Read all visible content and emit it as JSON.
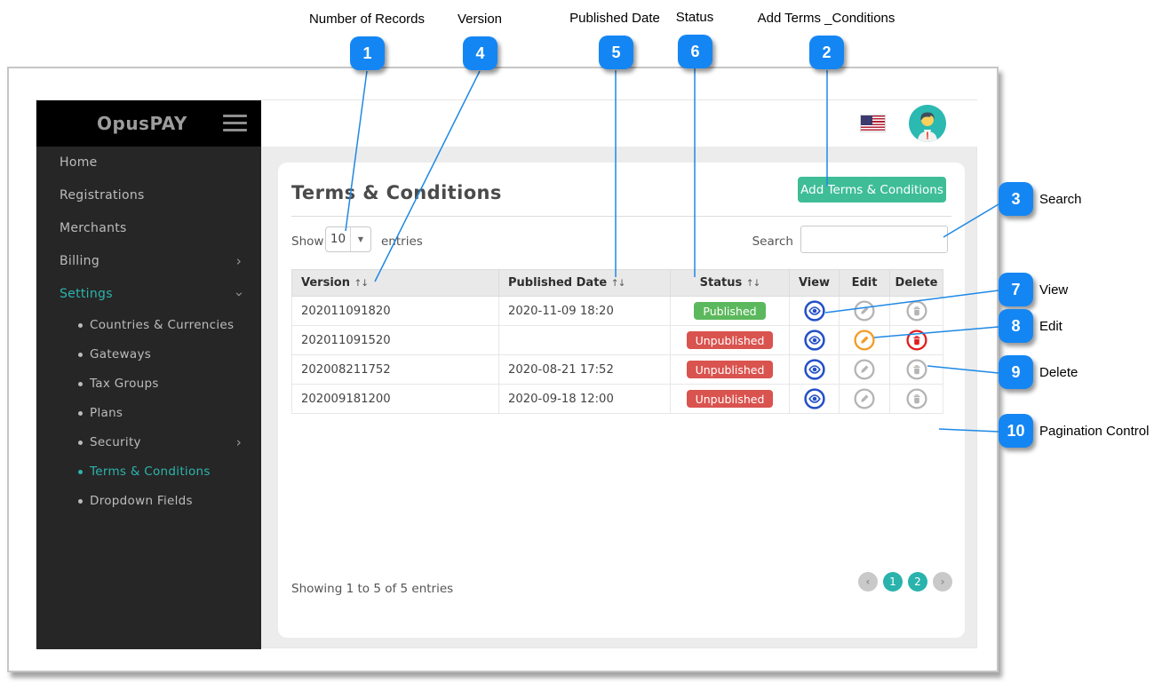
{
  "callouts": {
    "top": [
      {
        "num": "1",
        "label": "Number of Records"
      },
      {
        "num": "4",
        "label": "Version"
      },
      {
        "num": "5",
        "label": "Published Date"
      },
      {
        "num": "6",
        "label": "Status"
      },
      {
        "num": "2",
        "label": "Add Terms _Conditions"
      }
    ],
    "right": [
      {
        "num": "3",
        "label": "Search"
      },
      {
        "num": "7",
        "label": "View"
      },
      {
        "num": "8",
        "label": "Edit"
      },
      {
        "num": "9",
        "label": "Delete"
      },
      {
        "num": "10",
        "label": "Pagination Control"
      }
    ]
  },
  "sidebar": {
    "brand": "OpusPAY",
    "items": [
      {
        "label": "Home"
      },
      {
        "label": "Registrations"
      },
      {
        "label": "Merchants"
      },
      {
        "label": "Billing",
        "chevron": "›"
      },
      {
        "label": "Settings",
        "chevron": "›"
      }
    ],
    "settings_subitems": [
      {
        "label": "Countries & Currencies"
      },
      {
        "label": "Gateways"
      },
      {
        "label": "Tax Groups"
      },
      {
        "label": "Plans"
      },
      {
        "label": "Security",
        "chevron": "›"
      },
      {
        "label": "Terms & Conditions"
      },
      {
        "label": "Dropdown Fields"
      }
    ]
  },
  "main": {
    "title": "Terms & Conditions",
    "add_button_label": "Add Terms & Conditions",
    "show_label": "Show",
    "page_size": "10",
    "dropdown_caret": "▼",
    "entries_label": "entries",
    "search_label": "Search",
    "sort_icon": "↑↓",
    "table": {
      "headers": {
        "version": "Version",
        "published": "Published Date",
        "status": "Status",
        "view": "View",
        "edit": "Edit",
        "delete": "Delete"
      },
      "rows": [
        {
          "version": "202011091820",
          "published": "2020-11-09 18:20",
          "status": "Published"
        },
        {
          "version": "202011091520",
          "published": "",
          "status": "Unpublished"
        },
        {
          "version": "202008211752",
          "published": "2020-08-21 17:52",
          "status": "Unpublished"
        },
        {
          "version": "202009181200",
          "published": "2020-09-18 12:00",
          "status": "Unpublished"
        }
      ]
    },
    "summary": "Showing 1 to 5 of 5 entries",
    "pagination": {
      "prev": "‹",
      "pages": [
        "1",
        "2"
      ],
      "next": "›"
    }
  },
  "colors": {
    "callout_blue": "#1486f4",
    "accent_teal": "#2cb5ac",
    "button_green": "#3ebd97",
    "status_published_green": "#5cb85c",
    "status_unpublished_red": "#d9534f",
    "view_icon_blue": "#2350c8",
    "edit_icon_orange": "#f59a23",
    "delete_icon_red": "#e01d1d",
    "disabled_icon_gray": "#b4b4b4"
  }
}
